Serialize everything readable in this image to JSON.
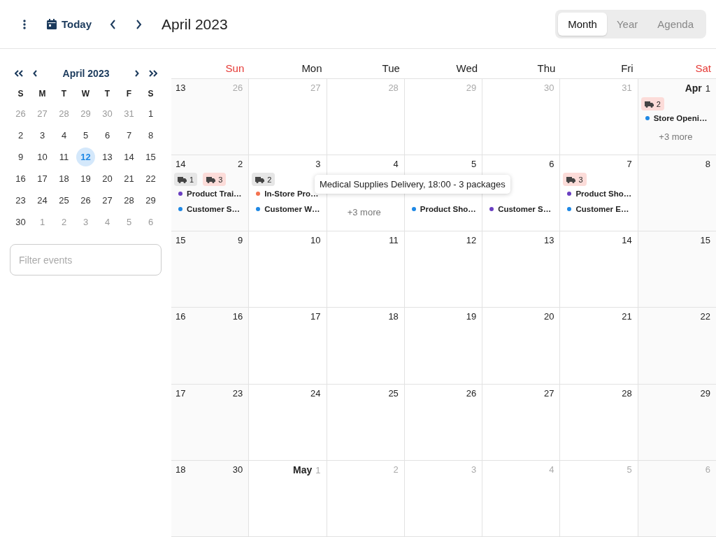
{
  "toolbar": {
    "today_label": "Today",
    "title": "April 2023",
    "views": [
      {
        "label": "Month",
        "selected": true
      },
      {
        "label": "Year",
        "selected": false
      },
      {
        "label": "Agenda",
        "selected": false
      }
    ]
  },
  "mini_calendar": {
    "title": "April 2023",
    "weekdays": [
      "S",
      "M",
      "T",
      "W",
      "T",
      "F",
      "S"
    ],
    "weeks": [
      [
        {
          "day": "26",
          "muted": true,
          "selected": false
        },
        {
          "day": "27",
          "muted": true,
          "selected": false
        },
        {
          "day": "28",
          "muted": true,
          "selected": false
        },
        {
          "day": "29",
          "muted": true,
          "selected": false
        },
        {
          "day": "30",
          "muted": true,
          "selected": false
        },
        {
          "day": "31",
          "muted": true,
          "selected": false
        },
        {
          "day": "1",
          "muted": false,
          "selected": false
        }
      ],
      [
        {
          "day": "2",
          "muted": false,
          "selected": false
        },
        {
          "day": "3",
          "muted": false,
          "selected": false
        },
        {
          "day": "4",
          "muted": false,
          "selected": false
        },
        {
          "day": "5",
          "muted": false,
          "selected": false
        },
        {
          "day": "6",
          "muted": false,
          "selected": false
        },
        {
          "day": "7",
          "muted": false,
          "selected": false
        },
        {
          "day": "8",
          "muted": false,
          "selected": false
        }
      ],
      [
        {
          "day": "9",
          "muted": false,
          "selected": false
        },
        {
          "day": "10",
          "muted": false,
          "selected": false
        },
        {
          "day": "11",
          "muted": false,
          "selected": false
        },
        {
          "day": "12",
          "muted": false,
          "selected": true
        },
        {
          "day": "13",
          "muted": false,
          "selected": false
        },
        {
          "day": "14",
          "muted": false,
          "selected": false
        },
        {
          "day": "15",
          "muted": false,
          "selected": false
        }
      ],
      [
        {
          "day": "16",
          "muted": false,
          "selected": false
        },
        {
          "day": "17",
          "muted": false,
          "selected": false
        },
        {
          "day": "18",
          "muted": false,
          "selected": false
        },
        {
          "day": "19",
          "muted": false,
          "selected": false
        },
        {
          "day": "20",
          "muted": false,
          "selected": false
        },
        {
          "day": "21",
          "muted": false,
          "selected": false
        },
        {
          "day": "22",
          "muted": false,
          "selected": false
        }
      ],
      [
        {
          "day": "23",
          "muted": false,
          "selected": false
        },
        {
          "day": "24",
          "muted": false,
          "selected": false
        },
        {
          "day": "25",
          "muted": false,
          "selected": false
        },
        {
          "day": "26",
          "muted": false,
          "selected": false
        },
        {
          "day": "27",
          "muted": false,
          "selected": false
        },
        {
          "day": "28",
          "muted": false,
          "selected": false
        },
        {
          "day": "29",
          "muted": false,
          "selected": false
        }
      ],
      [
        {
          "day": "30",
          "muted": false,
          "selected": false
        },
        {
          "day": "1",
          "muted": true,
          "selected": false
        },
        {
          "day": "2",
          "muted": true,
          "selected": false
        },
        {
          "day": "3",
          "muted": true,
          "selected": false
        },
        {
          "day": "4",
          "muted": true,
          "selected": false
        },
        {
          "day": "5",
          "muted": true,
          "selected": false
        },
        {
          "day": "6",
          "muted": true,
          "selected": false
        }
      ]
    ]
  },
  "filter": {
    "placeholder": "Filter events"
  },
  "calendar": {
    "weekdays": [
      {
        "label": "Sun",
        "weekend": true
      },
      {
        "label": "Mon",
        "weekend": false
      },
      {
        "label": "Tue",
        "weekend": false
      },
      {
        "label": "Wed",
        "weekend": false
      },
      {
        "label": "Thu",
        "weekend": false
      },
      {
        "label": "Fri",
        "weekend": false
      },
      {
        "label": "Sat",
        "weekend": true
      }
    ],
    "weeks": [
      {
        "number": "13",
        "days": [
          {
            "day": "26",
            "muted": true
          },
          {
            "day": "27",
            "muted": true
          },
          {
            "day": "28",
            "muted": true
          },
          {
            "day": "29",
            "muted": true
          },
          {
            "day": "30",
            "muted": true
          },
          {
            "day": "31",
            "muted": true
          },
          {
            "day": "1",
            "month": "Apr",
            "muted": false,
            "badges": [
              {
                "color": "#fcdcd9",
                "count": "2"
              }
            ],
            "events": [
              {
                "text": "Store Openi…",
                "color": "#1e88e5"
              }
            ],
            "more": "+3 more"
          }
        ]
      },
      {
        "number": "14",
        "days": [
          {
            "day": "2",
            "muted": false,
            "badges": [
              {
                "color": "#e6e6e6",
                "count": "1"
              },
              {
                "color": "#fcdcd9",
                "count": "3"
              }
            ],
            "events": [
              {
                "text": "Product Trai…",
                "color": "#6a3fc1"
              },
              {
                "text": "Customer S…",
                "color": "#1e88e5"
              }
            ]
          },
          {
            "day": "3",
            "muted": false,
            "badges": [
              {
                "color": "#e6e6e6",
                "count": "2"
              }
            ],
            "events": [
              {
                "text": "In-Store Pro…",
                "color": "#f4724f"
              },
              {
                "text": "Customer W…",
                "color": "#1e88e5"
              }
            ]
          },
          {
            "day": "4",
            "muted": false,
            "kind": "covered",
            "more": "+3 more"
          },
          {
            "day": "5",
            "muted": false,
            "kind": "covered",
            "events": [
              {
                "text": "Product Sho…",
                "color": "#1e88e5"
              }
            ]
          },
          {
            "day": "6",
            "muted": false,
            "kind": "covered",
            "events": [
              {
                "text": "Customer S…",
                "color": "#6a3fc1"
              }
            ]
          },
          {
            "day": "7",
            "muted": false,
            "badges": [
              {
                "color": "#fcdcd9",
                "count": "3"
              }
            ],
            "events": [
              {
                "text": "Product Sho…",
                "color": "#6a3fc1"
              },
              {
                "text": "Customer E…",
                "color": "#1e88e5"
              }
            ]
          },
          {
            "day": "8",
            "muted": false
          }
        ]
      },
      {
        "number": "15",
        "days": [
          {
            "day": "9",
            "muted": false
          },
          {
            "day": "10",
            "muted": false
          },
          {
            "day": "11",
            "muted": false
          },
          {
            "day": "12",
            "muted": false
          },
          {
            "day": "13",
            "muted": false
          },
          {
            "day": "14",
            "muted": false
          },
          {
            "day": "15",
            "muted": false
          }
        ]
      },
      {
        "number": "16",
        "days": [
          {
            "day": "16",
            "muted": false
          },
          {
            "day": "17",
            "muted": false
          },
          {
            "day": "18",
            "muted": false
          },
          {
            "day": "19",
            "muted": false
          },
          {
            "day": "20",
            "muted": false
          },
          {
            "day": "21",
            "muted": false
          },
          {
            "day": "22",
            "muted": false
          }
        ]
      },
      {
        "number": "17",
        "days": [
          {
            "day": "23",
            "muted": false
          },
          {
            "day": "24",
            "muted": false
          },
          {
            "day": "25",
            "muted": false
          },
          {
            "day": "26",
            "muted": false
          },
          {
            "day": "27",
            "muted": false
          },
          {
            "day": "28",
            "muted": false
          },
          {
            "day": "29",
            "muted": false
          }
        ]
      },
      {
        "number": "18",
        "days": [
          {
            "day": "30",
            "muted": false
          },
          {
            "day": "1",
            "month": "May",
            "muted": true
          },
          {
            "day": "2",
            "muted": true
          },
          {
            "day": "3",
            "muted": true
          },
          {
            "day": "4",
            "muted": true
          },
          {
            "day": "5",
            "muted": true
          },
          {
            "day": "6",
            "muted": true
          }
        ]
      }
    ]
  },
  "tooltip": {
    "text": "Medical Supplies Delivery, 18:00 - 3 packages"
  }
}
